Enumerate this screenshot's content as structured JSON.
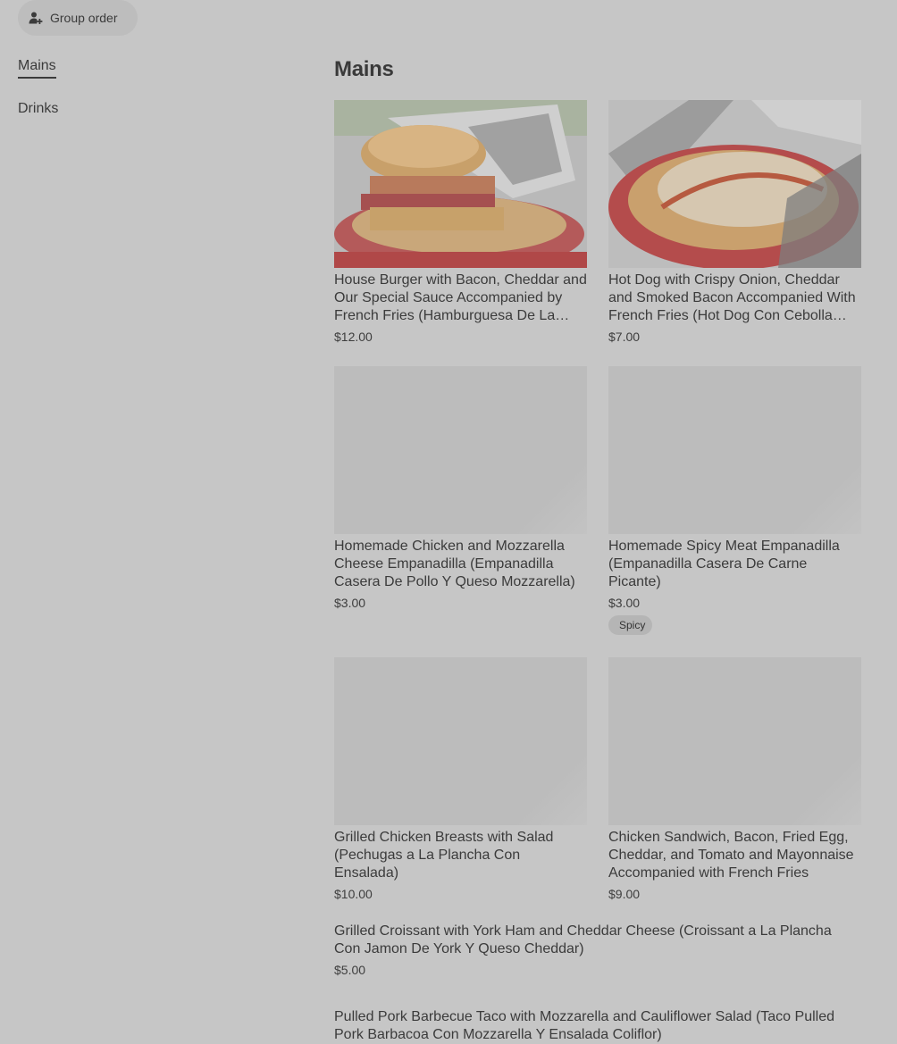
{
  "group_order": {
    "label": "Group order",
    "icon": "person-add-icon"
  },
  "sidebar": {
    "items": [
      {
        "label": "Mains",
        "active": true
      },
      {
        "label": "Drinks",
        "active": false
      }
    ]
  },
  "section": {
    "title": "Mains"
  },
  "cards": [
    {
      "name": "House Burger with Bacon, Cheddar and Our Special Sauce Accompanied by French Fries (Hamburguesa De La Casa Con Tocineta, Queso Cheddar y Nuestra Salsa Especial Acompañada De Papas Fritas)",
      "price": "$12.00",
      "image": "burger-photo"
    },
    {
      "name": "Hot Dog with Crispy Onion, Cheddar and Smoked Bacon Accompanied With French Fries (Hot Dog Con Cebolla Crujiente, Queso Cheddar y Tocineta Ahumada)",
      "price": "$7.00",
      "image": "hot-dog-photo"
    },
    {
      "name": "Homemade Chicken and Mozzarella Cheese Empanadilla (Empanadilla Casera De Pollo Y Queso Mozzarella)",
      "price": "$3.00",
      "image": "placeholder"
    },
    {
      "name": "Homemade Spicy Meat Empanadilla (Empanadilla Casera De Carne Picante)",
      "price": "$3.00",
      "badge": "Spicy",
      "image": "placeholder"
    },
    {
      "name": "Grilled Chicken Breasts with Salad (Pechugas a La Plancha Con Ensalada)",
      "price": "$10.00",
      "image": "placeholder"
    },
    {
      "name": "Chicken Sandwich, Bacon, Fried Egg, Cheddar, and Tomato and Mayonnaise Accompanied with French Fries",
      "price": "$9.00",
      "image": "placeholder"
    }
  ],
  "list_items": [
    {
      "name": "Grilled Croissant with York Ham and Cheddar Cheese (Croissant a La Plancha Con Jamon De York Y Queso Cheddar)",
      "price": "$5.00"
    },
    {
      "name": "Pulled Pork Barbecue Taco with Mozzarella and Cauliflower Salad (Taco Pulled Pork Barbacoa Con Mozzarella Y Ensalada Coliflor)",
      "price": ""
    }
  ]
}
